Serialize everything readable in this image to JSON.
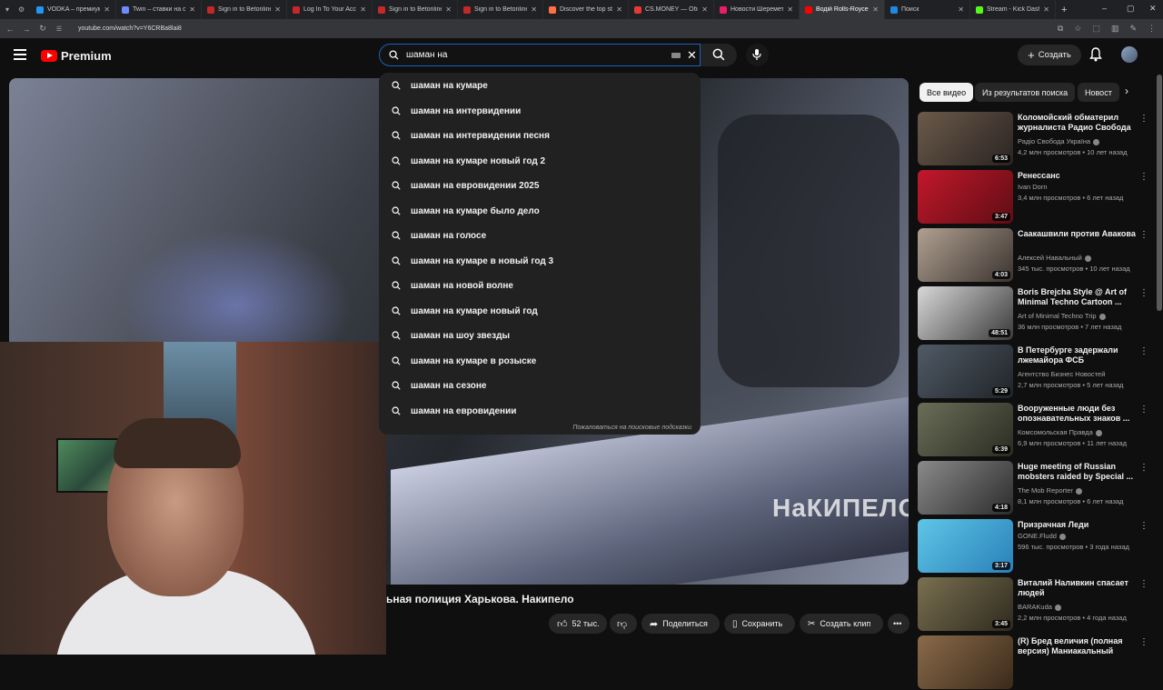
{
  "browser": {
    "tabs": [
      {
        "label": "VODKA – премиум ст",
        "color": "#2196f3"
      },
      {
        "label": "Twin – ставки на спо",
        "color": "#6c8cff"
      },
      {
        "label": "Sign in to Betonline",
        "color": "#c62828"
      },
      {
        "label": "Log In To Your Accou",
        "color": "#c62828"
      },
      {
        "label": "Sign in to Betonline",
        "color": "#c62828"
      },
      {
        "label": "Sign in to Betonline",
        "color": "#c62828"
      },
      {
        "label": "Discover the top strea",
        "color": "#ff7043"
      },
      {
        "label": "CS.MONEY — Обмен",
        "color": "#e53935"
      },
      {
        "label": "Новости Шереметa",
        "color": "#e91e63"
      },
      {
        "label": "Водій Rolls-Royce vs",
        "color": "#ff0000",
        "active": true
      },
      {
        "label": "Поиск",
        "color": "#1e88e5"
      },
      {
        "label": "Stream - Kick Dashbo",
        "color": "#53fc18"
      }
    ],
    "url": "youtube.com/watch?v=Y6CRBa8lai8"
  },
  "header": {
    "logo_text": "Premium",
    "search_value": "шаман на",
    "create_label": "Создать"
  },
  "suggestions": [
    "шаман на кумаре",
    "шаман на интервидении",
    "шаман на интервидении песня",
    "шаман на кумаре новый год 2",
    "шаман на евровидении 2025",
    "шаман на кумаре было дело",
    "шаман на голосе",
    "шаман на кумаре в новый год 3",
    "шаман на новой волне",
    "шаман на кумаре новый год",
    "шаман на шоу звезды",
    "шаман на кумаре в розыске",
    "шаман на сезоне",
    "шаман на евровидении"
  ],
  "report_text": "Пожаловаться на поисковые подсказки",
  "video": {
    "watermark": "НаКИПЕЛО",
    "title": "ьная полиция Харькова. Накипело",
    "likes": "52 тыс.",
    "share": "Поделиться",
    "save": "Сохранить",
    "clip": "Создать клип"
  },
  "chips": [
    "Все видео",
    "Из результатов поиска",
    "Новост"
  ],
  "related": [
    {
      "title": "Коломойский обматерил журналиста Радио Свобода ...",
      "channel": "Радіо Свобода Україна",
      "meta": "4,2 млн просмотров • 10 лет назад",
      "duration": "6:53",
      "verified": true,
      "colors": [
        "#6b5a4a",
        "#2a2422"
      ]
    },
    {
      "title": "Ренессанс",
      "channel": "Ivan Dorn",
      "meta": "3,4 млн просмотров • 6 лет назад",
      "duration": "3:47",
      "verified": false,
      "colors": [
        "#c2182b",
        "#5e0d14"
      ]
    },
    {
      "title": "Саакашвили против Авакова",
      "channel": "Алексей Навальный",
      "meta": "345 тыс. просмотров • 10 лет назад",
      "duration": "4:03",
      "verified": true,
      "colors": [
        "#b0a090",
        "#3b3430"
      ]
    },
    {
      "title": "Boris Brejcha Style @ Art of Minimal Techno Cartoon ...",
      "channel": "Art of Minimal Techno Trip",
      "meta": "36 млн просмотров • 7 лет назад",
      "duration": "48:51",
      "verified": true,
      "colors": [
        "#d8d8d8",
        "#3a3a3a"
      ]
    },
    {
      "title": "В Петербурге задержали лжемайора ФСБ",
      "channel": "Агентство Бизнес Новостей",
      "meta": "2,7 млн просмотров • 5 лет назад",
      "duration": "5:29",
      "verified": false,
      "colors": [
        "#505a66",
        "#202428"
      ]
    },
    {
      "title": "Вооруженные люди без опознавательных знаков ...",
      "channel": "Комсомольская Правда",
      "meta": "6,9 млн просмотров • 11 лет назад",
      "duration": "6:39",
      "verified": true,
      "colors": [
        "#6a6e58",
        "#2a2c22"
      ]
    },
    {
      "title": "Huge meeting of Russian mobsters raided by Special ...",
      "channel": "The Mob Reporter",
      "meta": "8,1 млн просмотров • 6 лет назад",
      "duration": "4:18",
      "verified": true,
      "colors": [
        "#8a8a8a",
        "#2c2c2c"
      ]
    },
    {
      "title": "Призрачная Леди",
      "channel": "GONE.Fludd",
      "meta": "596 тыс. просмотров • 3 года назад",
      "duration": "3:17",
      "verified": true,
      "colors": [
        "#5fc6e6",
        "#2980b9"
      ]
    },
    {
      "title": "Виталий Наливкин спасает людей",
      "channel": "BARAKuda",
      "meta": "2,2 млн просмотров • 4 года назад",
      "duration": "3:45",
      "verified": true,
      "colors": [
        "#7a7050",
        "#2e2a1e"
      ]
    },
    {
      "title": "(R) Бред величия (полная версия) Маниакальный",
      "channel": "",
      "meta": "",
      "duration": "",
      "verified": false,
      "colors": [
        "#8a6a4a",
        "#3a2a1a"
      ]
    }
  ]
}
